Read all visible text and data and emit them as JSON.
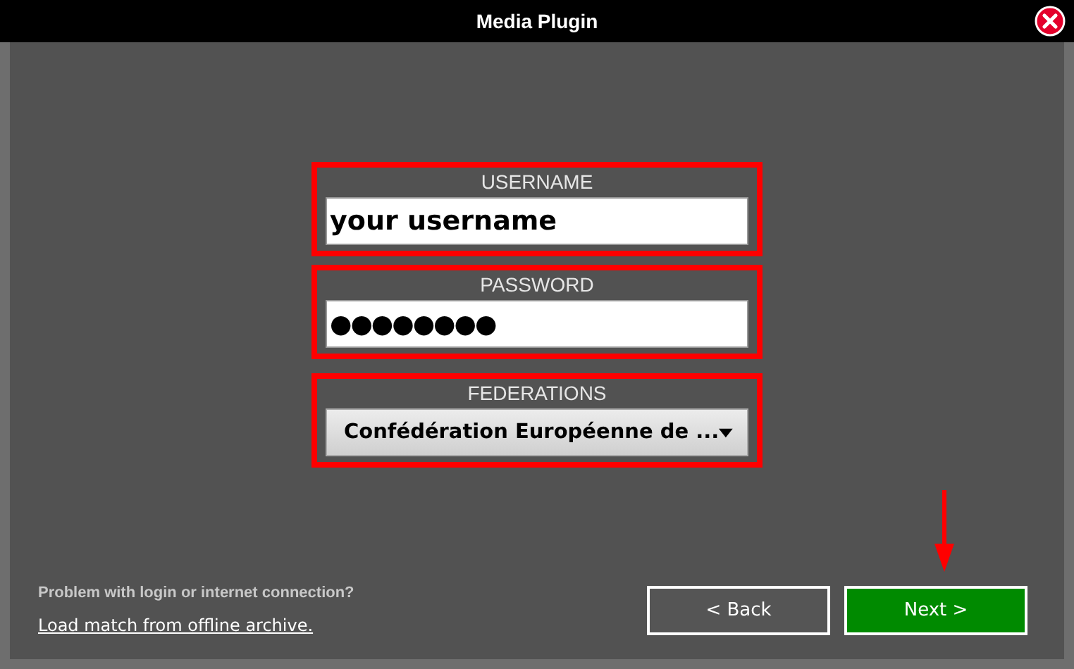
{
  "window": {
    "title": "Media Plugin"
  },
  "fields": [
    {
      "kind": "text",
      "label": "USERNAME",
      "value": "your username",
      "highlighted": true
    },
    {
      "kind": "password",
      "label": "PASSWORD",
      "value": "●●●●●●●●",
      "highlighted": true
    },
    {
      "kind": "dropdown",
      "label": "FEDERATIONS",
      "value": "Confédération Européenne de ...",
      "highlighted": true
    }
  ],
  "help_text": "Problem with login or internet connection?",
  "offline_link": "Load match from offline archive.",
  "buttons": [
    {
      "label": "< Back",
      "kind": "secondary",
      "pointer_arrow": false
    },
    {
      "label": "Next >",
      "kind": "primary",
      "pointer_arrow": true
    }
  ]
}
